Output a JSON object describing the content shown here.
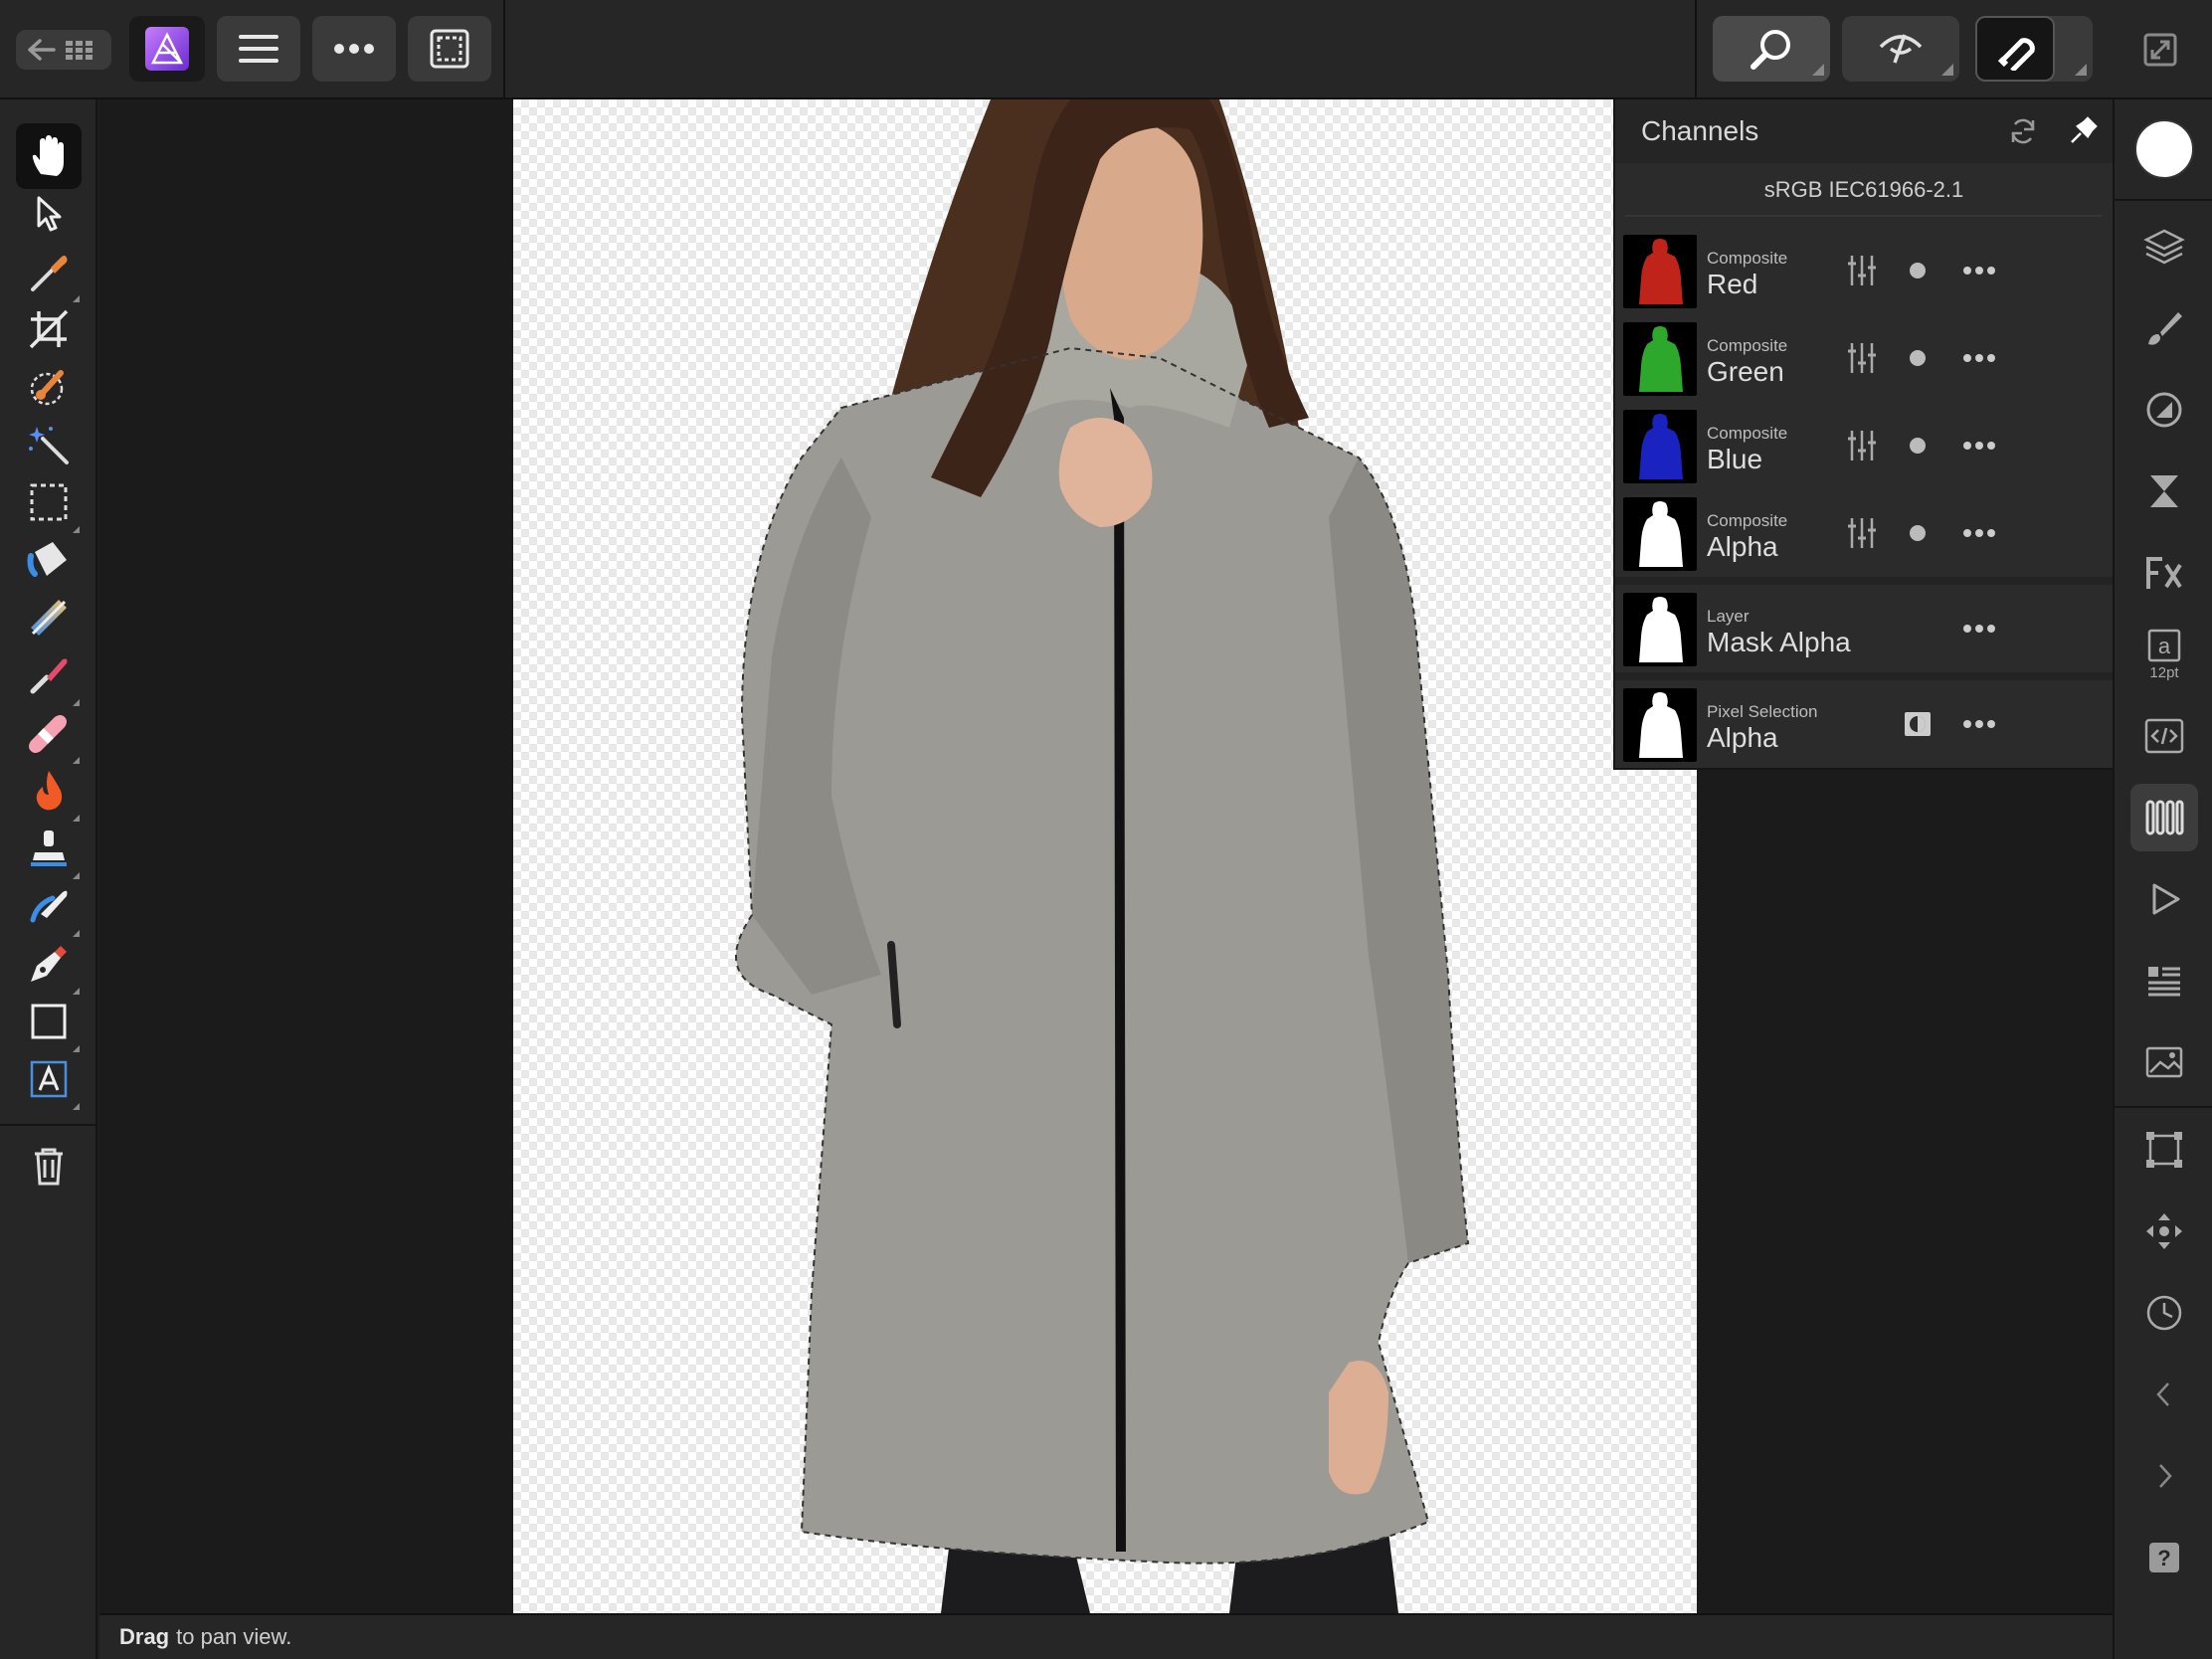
{
  "app": {
    "name": "Affinity Photo",
    "accent": "#8f4bd9"
  },
  "topbar": {
    "items": [
      {
        "name": "back-to-home",
        "icon": "arrow-left-grid-icon"
      },
      {
        "name": "app-menu",
        "icon": "affinity-photo-logo-icon"
      },
      {
        "name": "document-menu",
        "icon": "hamburger-icon"
      },
      {
        "name": "more-menu",
        "icon": "ellipsis-icon"
      },
      {
        "name": "selection-menu",
        "icon": "marquee-icon"
      },
      {
        "name": "view-tool",
        "icon": "magnifier-icon"
      },
      {
        "name": "view-mode",
        "icon": "eye-slash-icon"
      },
      {
        "name": "snapping",
        "icon": "magnet-icon"
      },
      {
        "name": "fullscreen",
        "icon": "expand-icon"
      }
    ]
  },
  "left_tools": [
    {
      "name": "hand-tool",
      "icon": "hand-icon",
      "active": true
    },
    {
      "name": "move-tool",
      "icon": "arrow-pointer-icon"
    },
    {
      "name": "color-picker-tool",
      "icon": "eyedropper-icon"
    },
    {
      "name": "crop-tool",
      "icon": "crop-icon"
    },
    {
      "name": "selection-brush-tool",
      "icon": "selection-brush-icon"
    },
    {
      "name": "flood-select-tool",
      "icon": "magic-wand-icon"
    },
    {
      "name": "marquee-tool",
      "icon": "dashed-rectangle-icon"
    },
    {
      "name": "flood-fill-tool",
      "icon": "paint-bucket-icon"
    },
    {
      "name": "gradient-tool",
      "icon": "gradient-icon"
    },
    {
      "name": "paint-brush-tool",
      "icon": "paint-brush-icon"
    },
    {
      "name": "healing-brush-tool",
      "icon": "bandage-icon"
    },
    {
      "name": "burn-tool",
      "icon": "flame-icon"
    },
    {
      "name": "clone-tool",
      "icon": "stamp-icon"
    },
    {
      "name": "smudge-tool",
      "icon": "smudge-icon"
    },
    {
      "name": "pen-tool",
      "icon": "pen-nib-icon"
    },
    {
      "name": "rectangle-tool",
      "icon": "rectangle-icon"
    },
    {
      "name": "artistic-text-tool",
      "icon": "text-frame-icon"
    },
    {
      "name": "trash-tool",
      "icon": "trash-icon"
    }
  ],
  "right_tools": [
    {
      "name": "color-studio",
      "icon": "color-swatch-icon"
    },
    {
      "name": "layers-studio",
      "icon": "layers-icon"
    },
    {
      "name": "brushes-studio",
      "icon": "brush-icon"
    },
    {
      "name": "adjustments-studio",
      "icon": "adjustment-icon"
    },
    {
      "name": "history-studio",
      "icon": "hourglass-icon"
    },
    {
      "name": "fx-studio",
      "icon": "fx-icon"
    },
    {
      "name": "text-studio",
      "icon": "text-size-icon",
      "label": "12pt"
    },
    {
      "name": "macro-studio",
      "icon": "code-icon"
    },
    {
      "name": "channels-studio",
      "icon": "channels-icon",
      "active": true
    },
    {
      "name": "play-studio",
      "icon": "play-icon"
    },
    {
      "name": "stock-studio",
      "icon": "list-icon"
    },
    {
      "name": "image-studio",
      "icon": "image-icon"
    },
    {
      "name": "transform-studio",
      "icon": "transform-icon"
    },
    {
      "name": "navigator-studio",
      "icon": "move-arrows-icon"
    },
    {
      "name": "time-studio",
      "icon": "clock-icon"
    },
    {
      "name": "previous-studio",
      "icon": "chevron-left-icon"
    },
    {
      "name": "next-studio",
      "icon": "chevron-right-icon"
    },
    {
      "name": "help",
      "icon": "question-icon"
    }
  ],
  "channels": {
    "title": "Channels",
    "profile": "sRGB IEC61966-2.1",
    "rows": [
      {
        "sub": "Composite",
        "name": "Red",
        "thumb": "#c0231a"
      },
      {
        "sub": "Composite",
        "name": "Green",
        "thumb": "#2ea82c"
      },
      {
        "sub": "Composite",
        "name": "Blue",
        "thumb": "#1a22c0"
      },
      {
        "sub": "Composite",
        "name": "Alpha",
        "thumb": "#ffffff"
      },
      {
        "sub": "Layer",
        "name": "Mask Alpha",
        "thumb": "#ffffff"
      },
      {
        "sub": "Pixel Selection",
        "name": "Alpha",
        "thumb": "#ffffff"
      }
    ]
  },
  "status": {
    "bold": "Drag",
    "text": "to pan view."
  }
}
